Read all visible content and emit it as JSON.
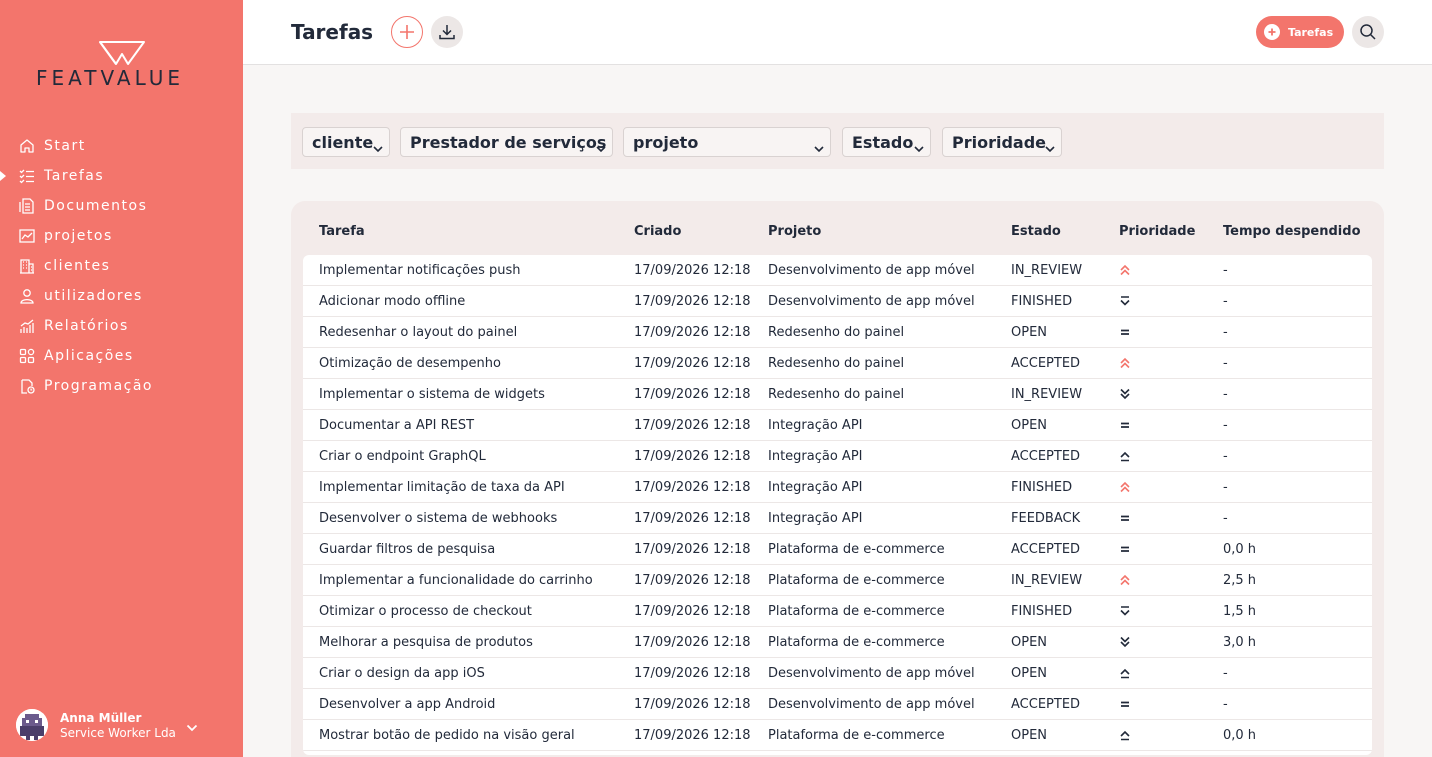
{
  "brand": {
    "logo_text": "FEATVALUE",
    "accent": "#f3756c",
    "dark": "#222a3a"
  },
  "sidebar": {
    "items": [
      {
        "label": "Start",
        "icon": "home-icon"
      },
      {
        "label": "Tarefas",
        "icon": "tasks-icon",
        "active": true
      },
      {
        "label": "Documentos",
        "icon": "documents-icon"
      },
      {
        "label": "projetos",
        "icon": "projects-chart-icon"
      },
      {
        "label": "clientes",
        "icon": "building-icon"
      },
      {
        "label": "utilizadores",
        "icon": "user-icon"
      },
      {
        "label": "Relatórios",
        "icon": "reports-icon"
      },
      {
        "label": "Aplicações",
        "icon": "apps-icon"
      },
      {
        "label": "Programação",
        "icon": "schedule-icon"
      }
    ],
    "user": {
      "name": "Anna Müller",
      "company": "Service Worker Lda"
    }
  },
  "header": {
    "title": "Tarefas",
    "tarefas_button": "Tarefas"
  },
  "filters": {
    "cliente": "cliente",
    "prestador": "Prestador de serviços",
    "projeto": "projeto",
    "estado": "Estado",
    "prioridade": "Prioridade"
  },
  "table": {
    "headers": {
      "tarefa": "Tarefa",
      "criado": "Criado",
      "projeto": "Projeto",
      "estado": "Estado",
      "prioridade": "Prioridade",
      "tempo": "Tempo despendido"
    },
    "rows": [
      {
        "tarefa": "Implementar notificações push",
        "criado": "17/09/2026 12:18",
        "projeto": "Desenvolvimento de app móvel",
        "estado": "IN_REVIEW",
        "prioridade": "highest",
        "tempo": "-"
      },
      {
        "tarefa": "Adicionar modo offline",
        "criado": "17/09/2026 12:18",
        "projeto": "Desenvolvimento de app móvel",
        "estado": "FINISHED",
        "prioridade": "low",
        "tempo": "-"
      },
      {
        "tarefa": "Redesenhar o layout do painel",
        "criado": "17/09/2026 12:18",
        "projeto": "Redesenho do painel",
        "estado": "OPEN",
        "prioridade": "medium",
        "tempo": "-"
      },
      {
        "tarefa": "Otimização de desempenho",
        "criado": "17/09/2026 12:18",
        "projeto": "Redesenho do painel",
        "estado": "ACCEPTED",
        "prioridade": "highest",
        "tempo": "-"
      },
      {
        "tarefa": "Implementar o sistema de widgets",
        "criado": "17/09/2026 12:18",
        "projeto": "Redesenho do painel",
        "estado": "IN_REVIEW",
        "prioridade": "lowest",
        "tempo": "-"
      },
      {
        "tarefa": "Documentar a API REST",
        "criado": "17/09/2026 12:18",
        "projeto": "Integração API",
        "estado": "OPEN",
        "prioridade": "medium",
        "tempo": "-"
      },
      {
        "tarefa": "Criar o endpoint GraphQL",
        "criado": "17/09/2026 12:18",
        "projeto": "Integração API",
        "estado": "ACCEPTED",
        "prioridade": "high",
        "tempo": "-"
      },
      {
        "tarefa": "Implementar limitação de taxa da API",
        "criado": "17/09/2026 12:18",
        "projeto": "Integração API",
        "estado": "FINISHED",
        "prioridade": "highest",
        "tempo": "-"
      },
      {
        "tarefa": "Desenvolver o sistema de webhooks",
        "criado": "17/09/2026 12:18",
        "projeto": "Integração API",
        "estado": "FEEDBACK",
        "prioridade": "medium",
        "tempo": "-"
      },
      {
        "tarefa": "Guardar filtros de pesquisa",
        "criado": "17/09/2026 12:18",
        "projeto": "Plataforma de e-commerce",
        "estado": "ACCEPTED",
        "prioridade": "medium",
        "tempo": "0,0 h"
      },
      {
        "tarefa": "Implementar a funcionalidade do carrinho",
        "criado": "17/09/2026 12:18",
        "projeto": "Plataforma de e-commerce",
        "estado": "IN_REVIEW",
        "prioridade": "highest",
        "tempo": "2,5 h"
      },
      {
        "tarefa": "Otimizar o processo de checkout",
        "criado": "17/09/2026 12:18",
        "projeto": "Plataforma de e-commerce",
        "estado": "FINISHED",
        "prioridade": "low",
        "tempo": "1,5 h"
      },
      {
        "tarefa": "Melhorar a pesquisa de produtos",
        "criado": "17/09/2026 12:18",
        "projeto": "Plataforma de e-commerce",
        "estado": "OPEN",
        "prioridade": "lowest",
        "tempo": "3,0 h"
      },
      {
        "tarefa": "Criar o design da app iOS",
        "criado": "17/09/2026 12:18",
        "projeto": "Desenvolvimento de app móvel",
        "estado": "OPEN",
        "prioridade": "high",
        "tempo": "-"
      },
      {
        "tarefa": "Desenvolver a app Android",
        "criado": "17/09/2026 12:18",
        "projeto": "Desenvolvimento de app móvel",
        "estado": "ACCEPTED",
        "prioridade": "medium",
        "tempo": "-"
      },
      {
        "tarefa": "Mostrar botão de pedido na visão geral",
        "criado": "17/09/2026 12:18",
        "projeto": "Plataforma de e-commerce",
        "estado": "OPEN",
        "prioridade": "high",
        "tempo": "0,0 h"
      }
    ]
  }
}
